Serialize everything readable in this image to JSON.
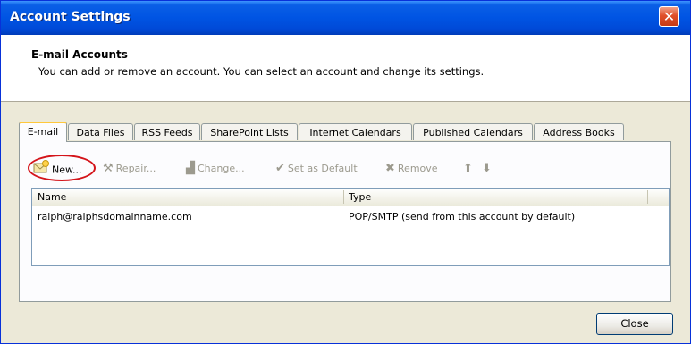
{
  "window": {
    "title": "Account Settings",
    "close_glyph": "✕"
  },
  "header": {
    "title": "E-mail Accounts",
    "description": "You can add or remove an account. You can select an account and change its settings."
  },
  "tabs": [
    {
      "label": "E-mail",
      "active": true
    },
    {
      "label": "Data Files",
      "active": false
    },
    {
      "label": "RSS Feeds",
      "active": false
    },
    {
      "label": "SharePoint Lists",
      "active": false
    },
    {
      "label": "Internet Calendars",
      "active": false
    },
    {
      "label": "Published Calendars",
      "active": false
    },
    {
      "label": "Address Books",
      "active": false
    }
  ],
  "toolbar": {
    "new_label": "New...",
    "repair_label": "Repair...",
    "change_label": "Change...",
    "set_default_label": "Set as Default",
    "remove_label": "Remove",
    "new_icon": "new-account-icon",
    "repair_icon": "repair-icon",
    "change_icon": "change-icon",
    "set_default_icon": "check-icon",
    "remove_icon": "remove-x-icon",
    "up_icon": "arrow-up-icon",
    "down_icon": "arrow-down-icon"
  },
  "table": {
    "columns": [
      "Name",
      "Type"
    ],
    "rows": [
      {
        "name": "ralph@ralphsdomainname.com",
        "type": "POP/SMTP (send from this account by default)"
      }
    ]
  },
  "footer": {
    "close_label": "Close"
  },
  "colors": {
    "titlebar": "#0054e3",
    "highlight_oval": "#d4141a",
    "active_tab_accent": "#ffc83c"
  }
}
